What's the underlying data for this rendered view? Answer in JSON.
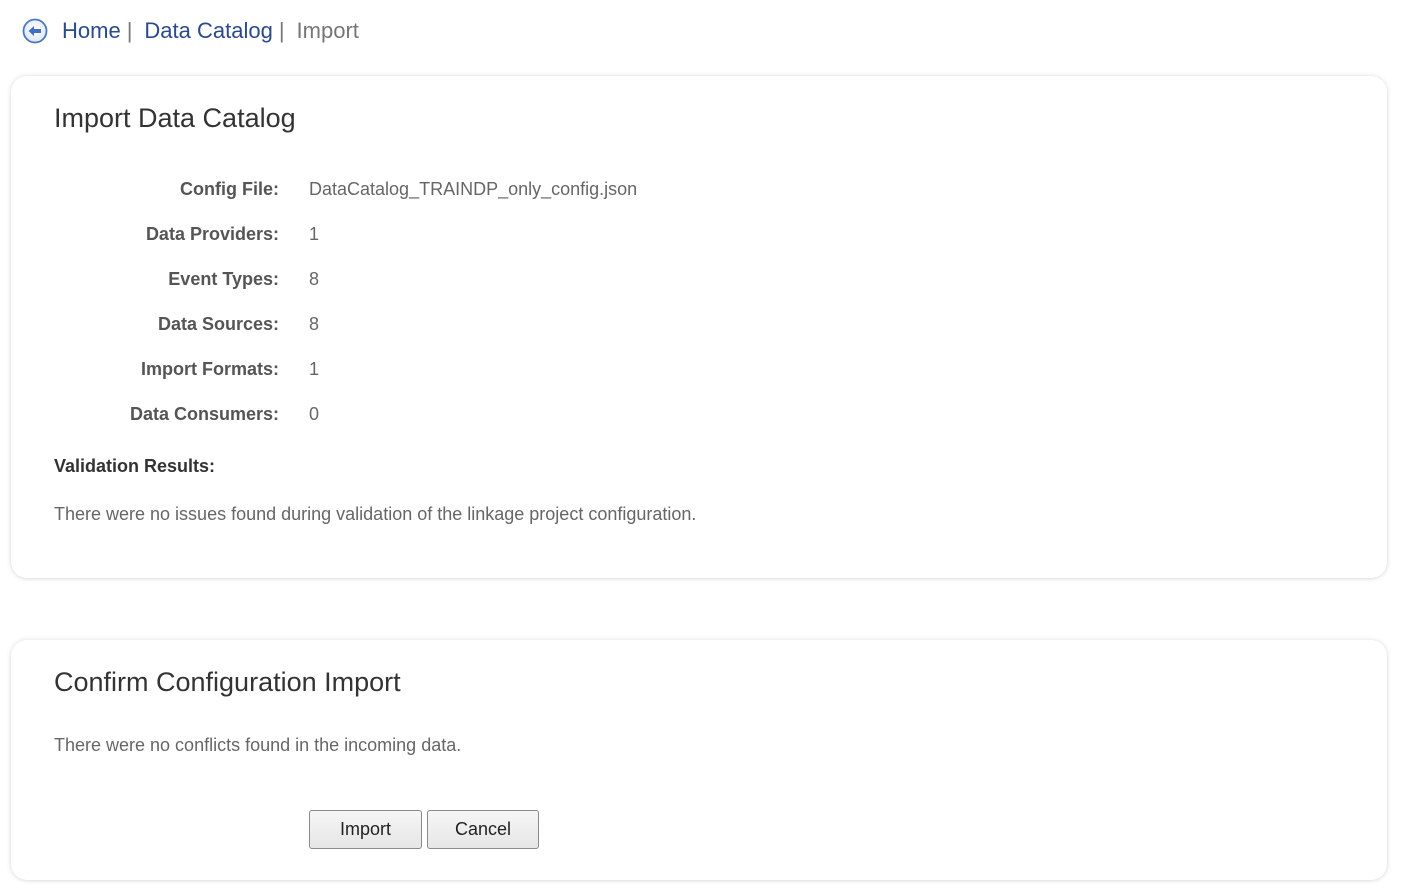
{
  "breadcrumb": {
    "home": "Home",
    "data_catalog": "Data Catalog",
    "separator": "|",
    "current": "Import"
  },
  "import_panel": {
    "title": "Import Data Catalog",
    "rows": [
      {
        "label": "Config File:",
        "value": "DataCatalog_TRAINDP_only_config.json"
      },
      {
        "label": "Data Providers:",
        "value": "1"
      },
      {
        "label": "Event Types:",
        "value": "8"
      },
      {
        "label": "Data Sources:",
        "value": "8"
      },
      {
        "label": "Import Formats:",
        "value": "1"
      },
      {
        "label": "Data Consumers:",
        "value": "0"
      }
    ],
    "validation_heading": "Validation Results:",
    "validation_text": "There were no issues found during validation of the linkage project configuration."
  },
  "confirm_panel": {
    "title": "Confirm Configuration Import",
    "text": "There were no conflicts found in the incoming data.",
    "import_label": "Import",
    "cancel_label": "Cancel"
  },
  "colors": {
    "link": "#2a4a8c",
    "back_icon": "#4a78c8"
  },
  "icons": {
    "back": "circle-left-arrow-icon"
  }
}
